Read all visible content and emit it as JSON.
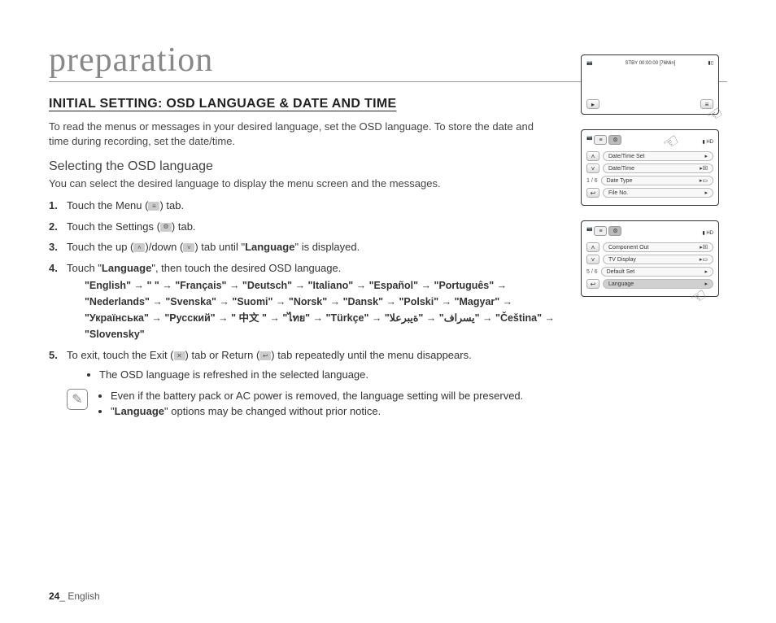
{
  "chapter": "preparation",
  "section": "INITIAL SETTING: OSD LANGUAGE & DATE AND TIME",
  "intro": "To read the menus or messages in your desired language, set the OSD language. To store the date and time during recording, set the date/time.",
  "subheading": "Selecting the OSD language",
  "subintro": "You can select the desired language to display the menu screen and the messages.",
  "steps": {
    "s1a": "Touch the Menu (",
    "s1b": ") tab.",
    "s2a": "Touch the Settings (",
    "s2b": ") tab.",
    "s3a": "Touch the up (",
    "s3b": ")/down (",
    "s3c": ") tab until \"",
    "s3lang": "Language",
    "s3d": "\" is displayed.",
    "s4a": "Touch \"",
    "s4lang": "Language",
    "s4b": "\", then touch the desired OSD language.",
    "s5a": "To exit, touch the Exit (",
    "s5b": ") tab or Return (",
    "s5c": ") tab repeatedly until the menu disappears.",
    "s5bullet": "The OSD language is refreshed in the selected language."
  },
  "lang_chain": "\"English\" → \"        \" → \"Français\" → \"Deutsch\" → \"Italiano\" → \"Español\" → \"Português\" → \"Nederlands\" → \"Svenska\" → \"Suomi\" → \"Norsk\" → \"Dansk\" → \"Polski\" → \"Magyar\" → \"Українська\" → \"Русский\" → \" 中文 \" → \"ไทย\" → \"Türkçe\" → \"يسراف\" → \"ةيبرعلا\" → \"Čeština\" → \"Slovensky\"",
  "note": {
    "n1": "Even if the battery pack or AC power is removed, the language setting will be preserved.",
    "n2a": "\"",
    "n2b": "Language",
    "n2c": "\" options may be changed without prior notice."
  },
  "screens": {
    "s1_top": "STBY 00:00:00  [76Min]",
    "s2": {
      "pager": "1 / 6",
      "items": [
        "Date/Time Set",
        "Date/Time",
        "Date Type",
        "File No."
      ]
    },
    "s3": {
      "pager": "5 / 6",
      "items": [
        "Component Out",
        "TV Display",
        "Default Set",
        "Language"
      ]
    }
  },
  "footer": {
    "page": "24",
    "sep": "_ ",
    "lang": "English"
  }
}
